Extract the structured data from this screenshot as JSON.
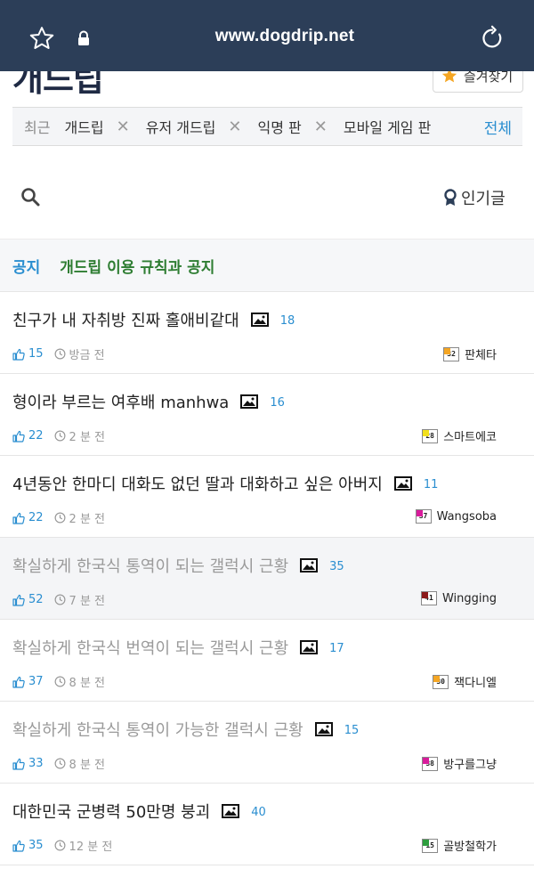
{
  "browser": {
    "url": "www.dogdrip.net"
  },
  "site": {
    "logo": "개드립",
    "bookmark_label": "즐겨찾기",
    "brand_color": "#2c3e58",
    "accent_color": "#2a8ed0"
  },
  "recent": {
    "label": "최근",
    "items": [
      {
        "label": "개드립"
      },
      {
        "label": "유저 개드립"
      },
      {
        "label": "익명 판"
      },
      {
        "label": "모바일 게임 판"
      }
    ],
    "all_label": "전체"
  },
  "tools": {
    "popular_label": "인기글"
  },
  "notice": {
    "tag": "공지",
    "title": "개드립 이용 규칙과 공지"
  },
  "posts": [
    {
      "title": "친구가 내 자취방 진짜 홀애비같대",
      "comments": "18",
      "likes": "15",
      "time": "방금 전",
      "level": "32",
      "level_color": "#f5a623",
      "author": "판체타",
      "read": false
    },
    {
      "title": "형이라 부르는 여후배 manhwa",
      "comments": "16",
      "likes": "22",
      "time": "2 분 전",
      "level": "28",
      "level_color": "#f2e01c",
      "author": "스마트에코",
      "read": false
    },
    {
      "title": "4년동안 한마디 대화도 없던 딸과 대화하고 싶은 아버지",
      "comments": "11",
      "likes": "22",
      "time": "2 분 전",
      "level": "37",
      "level_color": "#d81b9b",
      "author": "Wangsoba",
      "read": false
    },
    {
      "title": "확실하게 한국식 통역이 되는 갤럭시 근황",
      "comments": "35",
      "likes": "52",
      "time": "7 분 전",
      "level": "41",
      "level_color": "#8b1a1a",
      "author": "Wingging",
      "read": true
    },
    {
      "title": "확실하게 한국식 번역이 되는 갤럭시 근황",
      "comments": "17",
      "likes": "37",
      "time": "8 분 전",
      "level": "30",
      "level_color": "#f5a623",
      "author": "잭다니엘",
      "read": false,
      "faded": true
    },
    {
      "title": "확실하게 한국식 통역이 가능한 갤럭시 근황",
      "comments": "15",
      "likes": "33",
      "time": "8 분 전",
      "level": "38",
      "level_color": "#d81b9b",
      "author": "방구를그냥",
      "read": false,
      "faded": true
    },
    {
      "title": "대한민국 군병력 50만명 붕괴",
      "comments": "40",
      "likes": "35",
      "time": "12 분 전",
      "level": "15",
      "level_color": "#2e9e3e",
      "author": "골방철학가",
      "read": false
    }
  ]
}
